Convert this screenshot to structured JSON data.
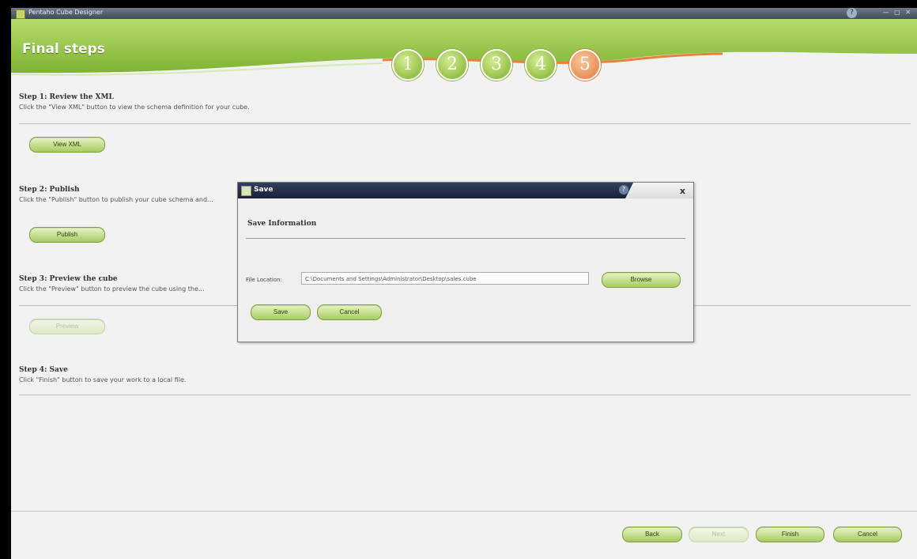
{
  "window": {
    "title": "Pentaho Cube Designer",
    "controls": "— ▢ ✕"
  },
  "banner": {
    "title": "Final steps",
    "steps": [
      "1",
      "2",
      "3",
      "4",
      "5"
    ],
    "active_step": "5"
  },
  "steps": [
    {
      "heading": "Step 1: Review the XML",
      "description": "Click the \"View XML\" button to view the schema definition for your cube.",
      "button": "View XML"
    },
    {
      "heading": "Step 2: Publish",
      "description": "Click the \"Publish\" button to publish your cube schema and...",
      "button": "Publish"
    },
    {
      "heading": "Step 3: Preview the cube",
      "description": "Click the \"Preview\" button to preview the cube using the...",
      "button": "Preview"
    },
    {
      "heading": "Step 4: Save",
      "description": "Click \"Finish\" button to save your work to a local file."
    }
  ],
  "dialog": {
    "title": "Save",
    "heading": "Save Information",
    "file_location_label": "File Location:",
    "file_location_value": "C:\\Documents and Settings\\Administrator\\Desktop\\sales.cube",
    "browse": "Browse",
    "save": "Save",
    "cancel": "Cancel",
    "help": "?",
    "close": "x"
  },
  "footer": {
    "back": "Back",
    "next": "Next",
    "finish": "Finish",
    "cancel": "Cancel"
  },
  "icons": {
    "help": "help-icon",
    "close": "close-icon",
    "app": "cube-icon"
  },
  "colors": {
    "accent_green": "#8dbb3e",
    "active_step_orange": "#e57a3c",
    "dialog_title": "#1d2a44"
  }
}
